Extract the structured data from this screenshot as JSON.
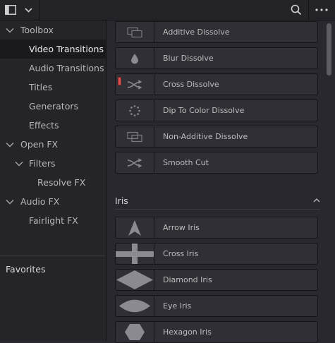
{
  "topbar": {
    "panel_toggle_icon": "panel-toggle-icon",
    "chevron_icon": "chevron-down-icon",
    "search_icon": "search-icon",
    "more_icon": "more-options-icon"
  },
  "sidebar": {
    "items": [
      {
        "label": "Toolbox",
        "expanded": true
      },
      {
        "label": "Video Transitions",
        "selected": true
      },
      {
        "label": "Audio Transitions"
      },
      {
        "label": "Titles"
      },
      {
        "label": "Generators"
      },
      {
        "label": "Effects"
      },
      {
        "label": "Open FX",
        "expanded": true
      },
      {
        "label": "Filters",
        "expanded": true
      },
      {
        "label": "Resolve FX"
      },
      {
        "label": "Audio FX",
        "expanded": true
      },
      {
        "label": "Fairlight FX"
      }
    ],
    "favorites_label": "Favorites"
  },
  "transitions": [
    {
      "label": "Additive Dissolve",
      "icon": "additive-dissolve-icon"
    },
    {
      "label": "Blur Dissolve",
      "icon": "drop-icon"
    },
    {
      "label": "Cross Dissolve",
      "icon": "cross-arrows-icon",
      "marked": true
    },
    {
      "label": "Dip To Color Dissolve",
      "icon": "dots-circle-icon"
    },
    {
      "label": "Non-Additive Dissolve",
      "icon": "overlap-frames-icon"
    },
    {
      "label": "Smooth Cut",
      "icon": "cross-arrows-icon"
    }
  ],
  "iris": {
    "section_title": "Iris",
    "collapse_icon": "chevron-up-icon",
    "items": [
      {
        "label": "Arrow Iris",
        "icon": "arrow-shape-icon"
      },
      {
        "label": "Cross Iris",
        "icon": "cross-shape-icon"
      },
      {
        "label": "Diamond Iris",
        "icon": "diamond-shape-icon"
      },
      {
        "label": "Eye Iris",
        "icon": "eye-shape-icon"
      },
      {
        "label": "Hexagon Iris",
        "icon": "hexagon-shape-icon"
      }
    ]
  },
  "colors": {
    "background": "#28282e",
    "sidebar": "#242429",
    "selected_row": "#1a1a1e",
    "marker": "#e05050"
  }
}
